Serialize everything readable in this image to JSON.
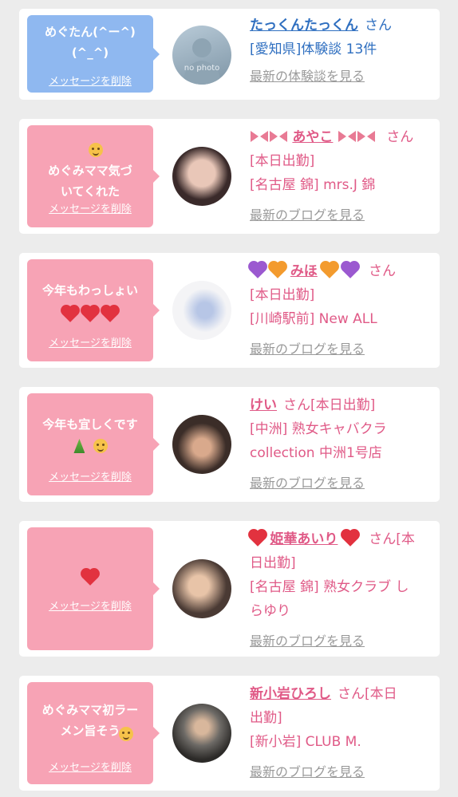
{
  "cards": [
    {
      "bubble_color": "#8fb8f0",
      "message": "めぐたん(^ー^)\n(^_^)",
      "delete_label": "メッセージを削除",
      "avatar_label": "no photo",
      "name": "たっくんたっくん",
      "suffix": "さん",
      "lines": [
        "[愛知県]体験談 13件"
      ],
      "link": "最新の体験談を見る"
    },
    {
      "bubble_color": "#f7a3b5",
      "message": "めぐみママ気づ\nいてくれた",
      "delete_label": "メッセージを削除",
      "name": "あやこ",
      "suffix": "さん",
      "lines": [
        "[本日出勤]",
        "[名古屋 錦] mrs.J 錦"
      ],
      "link": "最新のブログを見る"
    },
    {
      "bubble_color": "#f7a3b5",
      "message": "今年もわっしょい",
      "delete_label": "メッセージを削除",
      "name": "みほ",
      "suffix": "さん",
      "lines": [
        "[本日出勤]",
        "[川崎駅前] New ALL"
      ],
      "link": "最新のブログを見る"
    },
    {
      "bubble_color": "#f7a3b5",
      "message": "今年も宜しくです",
      "delete_label": "メッセージを削除",
      "name": "けい",
      "suffix": "さん[本日出勤]",
      "lines": [
        "[中洲] 熟女キャバクラ",
        "collection 中洲1号店"
      ],
      "link": "最新のブログを見る"
    },
    {
      "bubble_color": "#f7a3b5",
      "message": "",
      "delete_label": "メッセージを削除",
      "name": "姫華あいり",
      "suffix": "さん[本",
      "lines": [
        "日出勤]",
        "[名古屋 錦] 熟女クラブ し",
        "らゆり"
      ],
      "link": "最新のブログを見る"
    },
    {
      "bubble_color": "#f7a3b5",
      "message": "めぐみママ初ラー\nメン旨そう",
      "delete_label": "メッセージを削除",
      "name": "新小岩ひろし",
      "suffix": "さん[本日",
      "lines": [
        "出勤]",
        "[新小岩] CLUB M."
      ],
      "link": "最新のブログを見る"
    }
  ]
}
